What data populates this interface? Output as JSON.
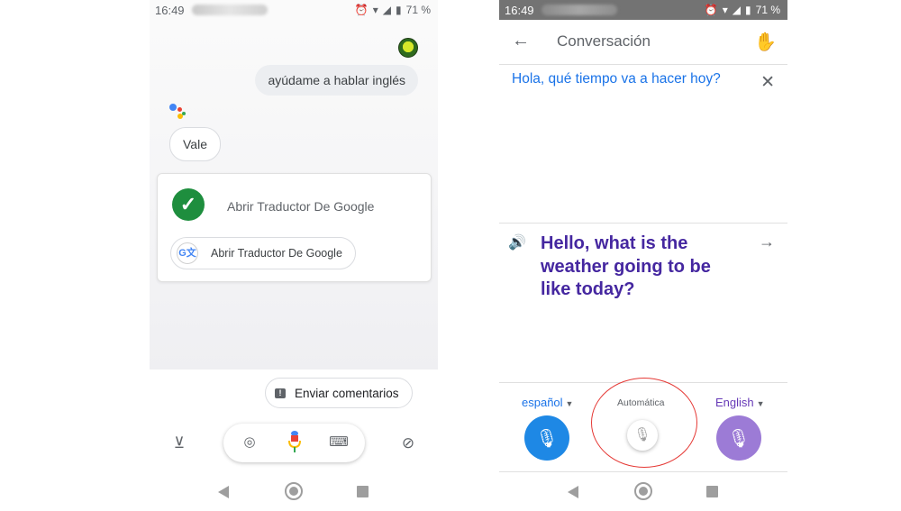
{
  "left_phone": {
    "status": {
      "time": "16:49",
      "battery": "71 %"
    },
    "user_message": "ayúdame a hablar inglés",
    "assistant_reply": "Vale",
    "card": {
      "title": "Abrir Traductor De Google",
      "chip_label": "Abrir Traductor De Google",
      "chip_icon": "google-translate-icon"
    },
    "feedback_label": "Enviar comentarios",
    "bottom_icons": [
      "updates-tray-icon",
      "lens-icon",
      "mic-icon",
      "keyboard-icon",
      "explore-icon"
    ],
    "nav_icons": [
      "back-icon",
      "home-icon",
      "recents-icon"
    ]
  },
  "right_phone": {
    "status": {
      "time": "16:49",
      "battery": "71 %"
    },
    "app_bar": {
      "title": "Conversación",
      "left_icon": "back-arrow-icon",
      "right_icon": "hand-wave-icon"
    },
    "source_text": "Hola, qué tiempo va a hacer hoy?",
    "target_text": "Hello, what is the weather going to be like today?",
    "languages": {
      "left": "español",
      "center": "Automática",
      "right": "English"
    },
    "nav_icons": [
      "back-icon",
      "home-icon",
      "recents-icon"
    ]
  },
  "colors": {
    "assistant_check": "#1e8e3e",
    "translate_blue": "#1a73e8",
    "mic_blue": "#1e88e5",
    "translation_purple": "#4527a0",
    "mic_purple": "#9c7bd6",
    "annotation_red": "#e53935",
    "status_bar_dark": "#737373"
  }
}
